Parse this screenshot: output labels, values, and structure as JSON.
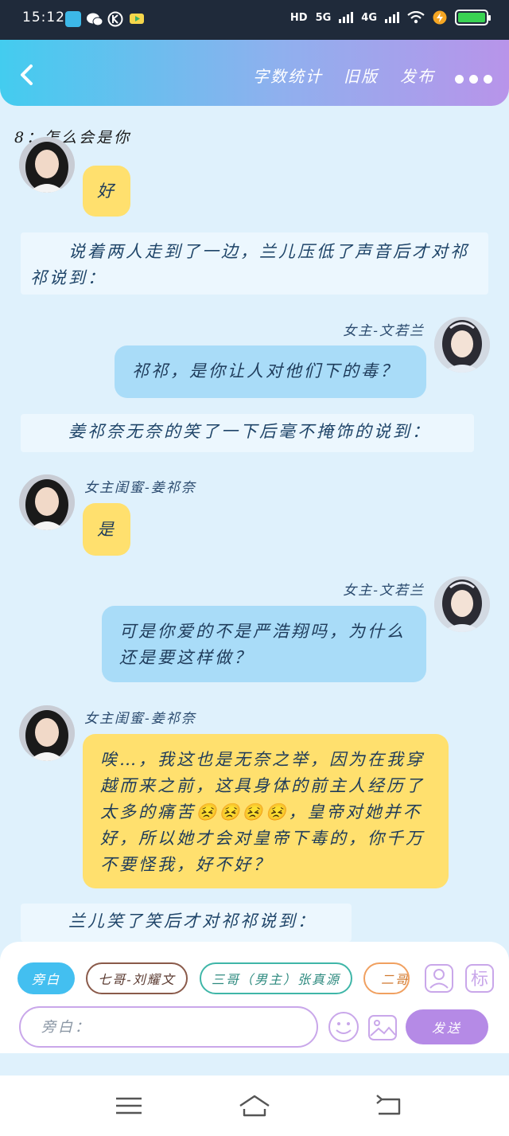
{
  "status_bar": {
    "time": "15:12",
    "network": "HD",
    "signal1": "5G",
    "signal2": "4G",
    "battery_icon": "battery-charging-icon",
    "colors": {
      "bg": "#1f2a3a",
      "battery": "#39d353"
    }
  },
  "header": {
    "word_count_label": "字数统计",
    "old_version_label": "旧版",
    "publish_label": "发布",
    "gradient": [
      "#43ccef",
      "#8fb0ee",
      "#b894ea"
    ]
  },
  "chapter_title": "8：怎么会是你",
  "messages": [
    {
      "type": "left",
      "name": "",
      "text": "好"
    },
    {
      "type": "narration",
      "text": "　　说着两人走到了一边，兰儿压低了声音后才对祁祁说到："
    },
    {
      "type": "right",
      "name": "女主-文若兰",
      "text": "祁祁，是你让人对他们下的毒？"
    },
    {
      "type": "narration",
      "text": "　　姜祁奈无奈的笑了一下后毫不掩饰的说到："
    },
    {
      "type": "left",
      "name": "女主闺蜜-姜祁奈",
      "text": "是"
    },
    {
      "type": "right",
      "name": "女主-文若兰",
      "text": "可是你爱的不是严浩翔吗，为什么还是要这样做？"
    },
    {
      "type": "left",
      "name": "女主闺蜜-姜祁奈",
      "text": "唉…，我这也是无奈之举，因为在我穿越而来之前，这具身体的前主人经历了太多的痛苦😣😣😣😣，皇帝对她并不好，所以她才会对皇帝下毒的，你千万不要怪我，好不好？"
    },
    {
      "type": "narration",
      "text": "　　兰儿笑了笑后才对祁祁说到："
    }
  ],
  "roles": [
    {
      "label": "旁白",
      "active": true
    },
    {
      "label": "七哥-刘耀文",
      "active": false
    },
    {
      "label": "三哥（男主）张真源",
      "active": false
    },
    {
      "label": "二哥-",
      "active": false
    }
  ],
  "input": {
    "placeholder": "旁白：",
    "value": "",
    "send_label": "发送"
  },
  "colors": {
    "yellow_bubble": "#ffe06e",
    "blue_bubble": "#a9dcf8",
    "send": "#b58ae6",
    "active_role": "#43bff0"
  }
}
